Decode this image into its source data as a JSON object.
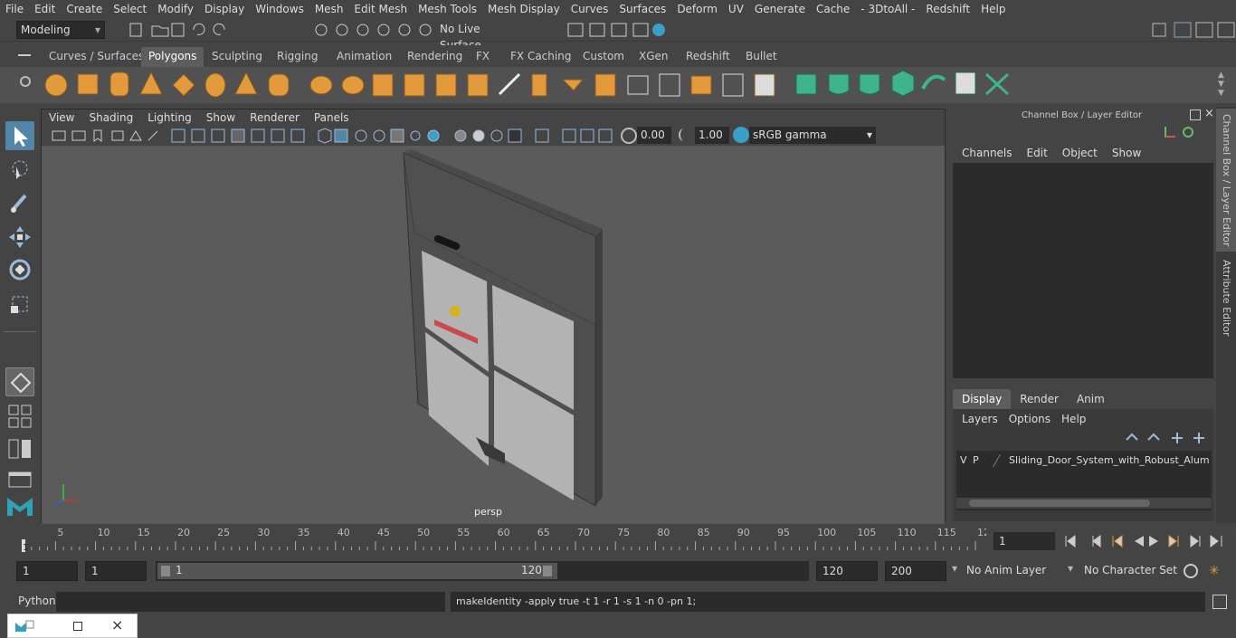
{
  "menubar": {
    "items": [
      "File",
      "Edit",
      "Create",
      "Select",
      "Modify",
      "Display",
      "Windows",
      "Mesh",
      "Edit Mesh",
      "Mesh Tools",
      "Mesh Display",
      "Curves",
      "Surfaces",
      "Deform",
      "UV",
      "Generate",
      "Cache",
      "- 3DtoAll -",
      "Redshift",
      "Help"
    ]
  },
  "status": {
    "mode": "Modeling",
    "live_surface": "No Live Surface"
  },
  "shelf": {
    "tabs": [
      "Curves / Surfaces",
      "Polygons",
      "Sculpting",
      "Rigging",
      "Animation",
      "Rendering",
      "FX",
      "FX Caching",
      "Custom",
      "XGen",
      "Redshift",
      "Bullet"
    ],
    "active": "Polygons"
  },
  "viewport": {
    "menu": [
      "View",
      "Shading",
      "Lighting",
      "Show",
      "Renderer",
      "Panels"
    ],
    "exposure": "0.00",
    "gamma": "1.00",
    "color_space": "sRGB gamma",
    "camera_label": "persp"
  },
  "channelbox": {
    "title": "Channel Box / Layer Editor",
    "menu": [
      "Channels",
      "Edit",
      "Object",
      "Show"
    ],
    "tabs": [
      "Display",
      "Render",
      "Anim"
    ],
    "active_tab": "Display",
    "layer_menu": [
      "Layers",
      "Options",
      "Help"
    ],
    "layer_v": "V",
    "layer_p": "P",
    "layer_name": "Sliding_Door_System_with_Robust_Alumini"
  },
  "sidetabs": [
    "Channel Box / Layer Editor",
    "Attribute Editor"
  ],
  "timeline": {
    "ticks": [
      "5",
      "10",
      "15",
      "20",
      "25",
      "30",
      "35",
      "40",
      "45",
      "50",
      "55",
      "60",
      "65",
      "70",
      "75",
      "80",
      "85",
      "90",
      "95",
      "100",
      "105",
      "110",
      "115",
      "12"
    ],
    "start_label": "1",
    "current_frame": "1"
  },
  "range": {
    "start": "1",
    "anim_start": "1",
    "slider_start": "1",
    "slider_end": "120",
    "end": "120",
    "anim_end": "200",
    "anim_layer": "No Anim Layer",
    "char_set": "No Character Set"
  },
  "cmd": {
    "lang": "Python",
    "result": "makeIdentity -apply true -t 1 -r 1 -s 1 -n 0 -pn 1;"
  },
  "colors": {
    "accent": "#5285a6",
    "shelf_orange": "#e39a3d",
    "shelf_green": "#3fb38c"
  }
}
